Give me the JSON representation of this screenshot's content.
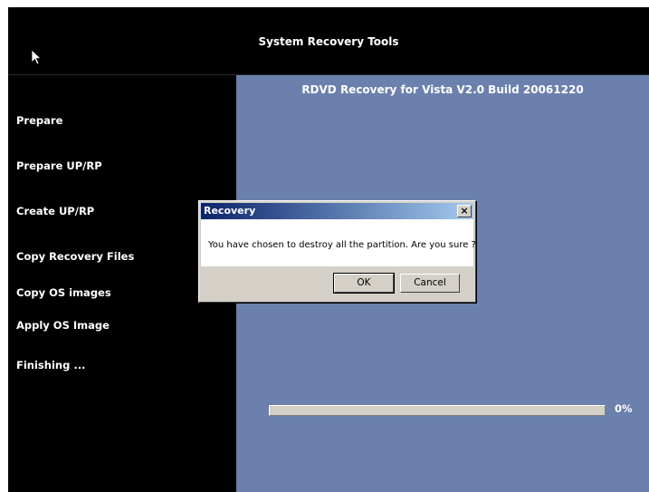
{
  "header": {
    "title": "System Recovery Tools"
  },
  "sidebar": {
    "steps": [
      {
        "label": "Prepare"
      },
      {
        "label": "Prepare UP/RP"
      },
      {
        "label": "Create UP/RP"
      },
      {
        "label": "Copy Recovery Files"
      },
      {
        "label": "Copy OS images"
      },
      {
        "label": "Apply OS Image"
      },
      {
        "label": "Finishing ..."
      }
    ]
  },
  "main": {
    "title": "RDVD Recovery for Vista V2.0 Build 20061220",
    "progress": {
      "value": 0,
      "label": "0%"
    }
  },
  "dialog": {
    "title": "Recovery",
    "close_glyph": "×",
    "message": "You have chosen to destroy all the partition. Are you sure ?",
    "ok_label": "OK",
    "cancel_label": "Cancel"
  },
  "colors": {
    "main_bg": "#6b80ad",
    "titlebar_start": "#0a246a",
    "titlebar_end": "#a6caf0",
    "dialog_face": "#d4d0c8"
  },
  "icons": {
    "cursor": "mouse-pointer-icon",
    "close": "close-icon"
  }
}
